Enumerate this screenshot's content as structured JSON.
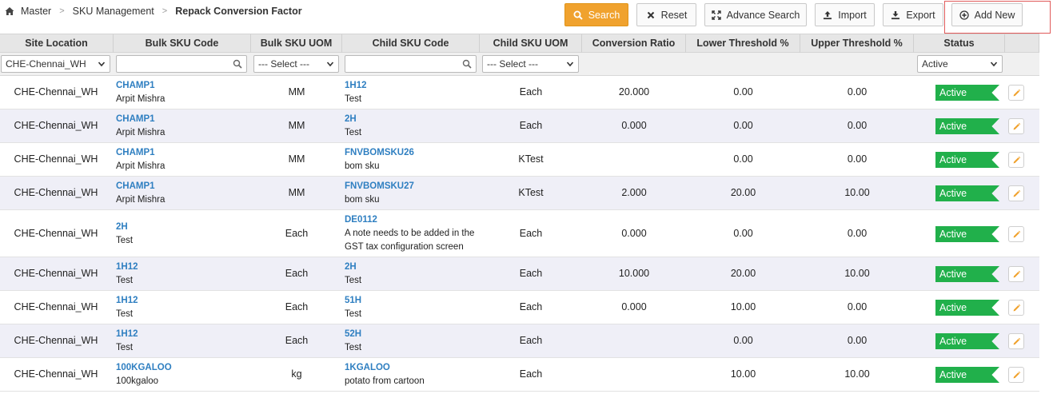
{
  "breadcrumb": {
    "home_icon": "home-icon",
    "items": [
      "Master",
      "SKU Management"
    ],
    "current": "Repack Conversion Factor",
    "separator": ">"
  },
  "toolbar": {
    "search": "Search",
    "reset": "Reset",
    "advance_search": "Advance Search",
    "import": "Import",
    "export": "Export",
    "add_new": "Add New"
  },
  "colors": {
    "accent": "#f0a22e",
    "status_active": "#21b04b",
    "link": "#2f7fc1",
    "highlight": "#e05a5a"
  },
  "columns": [
    "Site Location",
    "Bulk SKU Code",
    "Bulk SKU UOM",
    "Child SKU Code",
    "Child SKU UOM",
    "Conversion Ratio",
    "Lower Threshold %",
    "Upper Threshold %",
    "Status"
  ],
  "filters": {
    "site_location": "CHE-Chennai_WH",
    "bulk_sku_code": "",
    "bulk_sku_uom": "--- Select ---",
    "child_sku_code": "",
    "child_sku_uom": "--- Select ---",
    "status": "Active"
  },
  "rows": [
    {
      "site": "CHE-Chennai_WH",
      "bulk_code": "CHAMP1",
      "bulk_desc": "Arpit Mishra",
      "bulk_uom": "MM",
      "child_code": "1H12",
      "child_desc": "Test",
      "child_uom": "Each",
      "ratio": "20.000",
      "lower": "0.00",
      "upper": "0.00",
      "status": "Active"
    },
    {
      "site": "CHE-Chennai_WH",
      "bulk_code": "CHAMP1",
      "bulk_desc": "Arpit Mishra",
      "bulk_uom": "MM",
      "child_code": "2H",
      "child_desc": "Test",
      "child_uom": "Each",
      "ratio": "0.000",
      "lower": "0.00",
      "upper": "0.00",
      "status": "Active"
    },
    {
      "site": "CHE-Chennai_WH",
      "bulk_code": "CHAMP1",
      "bulk_desc": "Arpit Mishra",
      "bulk_uom": "MM",
      "child_code": "FNVBOMSKU26",
      "child_desc": "bom sku",
      "child_uom": "KTest",
      "ratio": "",
      "lower": "0.00",
      "upper": "0.00",
      "status": "Active"
    },
    {
      "site": "CHE-Chennai_WH",
      "bulk_code": "CHAMP1",
      "bulk_desc": "Arpit Mishra",
      "bulk_uom": "MM",
      "child_code": "FNVBOMSKU27",
      "child_desc": "bom sku",
      "child_uom": "KTest",
      "ratio": "2.000",
      "lower": "20.00",
      "upper": "10.00",
      "status": "Active"
    },
    {
      "site": "CHE-Chennai_WH",
      "bulk_code": "2H",
      "bulk_desc": "Test",
      "bulk_uom": "Each",
      "child_code": "DE0112",
      "child_desc": "A note needs to be added in the GST tax configuration screen",
      "child_uom": "Each",
      "ratio": "0.000",
      "lower": "0.00",
      "upper": "0.00",
      "status": "Active"
    },
    {
      "site": "CHE-Chennai_WH",
      "bulk_code": "1H12",
      "bulk_desc": "Test",
      "bulk_uom": "Each",
      "child_code": "2H",
      "child_desc": "Test",
      "child_uom": "Each",
      "ratio": "10.000",
      "lower": "20.00",
      "upper": "10.00",
      "status": "Active"
    },
    {
      "site": "CHE-Chennai_WH",
      "bulk_code": "1H12",
      "bulk_desc": "Test",
      "bulk_uom": "Each",
      "child_code": "51H",
      "child_desc": "Test",
      "child_uom": "Each",
      "ratio": "0.000",
      "lower": "10.00",
      "upper": "0.00",
      "status": "Active"
    },
    {
      "site": "CHE-Chennai_WH",
      "bulk_code": "1H12",
      "bulk_desc": "Test",
      "bulk_uom": "Each",
      "child_code": "52H",
      "child_desc": "Test",
      "child_uom": "Each",
      "ratio": "",
      "lower": "0.00",
      "upper": "0.00",
      "status": "Active"
    },
    {
      "site": "CHE-Chennai_WH",
      "bulk_code": "100KGALOO",
      "bulk_desc": "100kgaloo",
      "bulk_uom": "kg",
      "child_code": "1KGALOO",
      "child_desc": "potato from cartoon",
      "child_uom": "Each",
      "ratio": "",
      "lower": "10.00",
      "upper": "10.00",
      "status": "Active"
    }
  ]
}
